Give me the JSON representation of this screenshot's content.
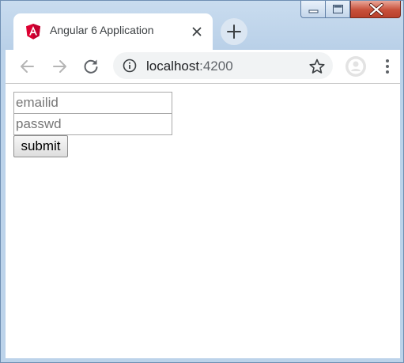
{
  "window": {
    "controls": {
      "minimize_icon": "minimize-icon",
      "maximize_icon": "maximize-icon",
      "close_icon": "close-icon"
    }
  },
  "tab": {
    "title": "Angular 6 Application",
    "favicon": "angular-logo-icon",
    "favicon_color": "#dd0031"
  },
  "toolbar": {
    "url_host": "localhost",
    "url_port": ":4200",
    "icons": [
      "back-icon",
      "forward-icon",
      "reload-icon",
      "info-icon",
      "star-icon",
      "profile-icon",
      "menu-icon"
    ]
  },
  "form": {
    "email": {
      "value": "",
      "placeholder": "emailid"
    },
    "password": {
      "value": "",
      "placeholder": "passwd"
    },
    "submit_label": "submit"
  }
}
